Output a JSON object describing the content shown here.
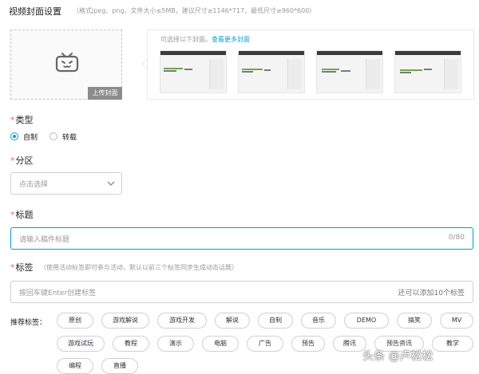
{
  "cover": {
    "title": "视频封面设置",
    "hint": "（格式jpeg、png，文件大小≤5MB，建议尺寸≥1146*717，最低尺寸≥960*600）",
    "upload_label": "上传封面",
    "suggest_text": "可选择以下封面。",
    "suggest_link": "查看更多封面"
  },
  "type": {
    "title": "类型",
    "options": [
      "自制",
      "转载"
    ],
    "selected": "自制"
  },
  "zone": {
    "title": "分区",
    "placeholder": "点击选择"
  },
  "video_title": {
    "title": "标题",
    "placeholder": "请输入稿件标题",
    "count": "0/80"
  },
  "tags": {
    "title": "标签",
    "hint": "（使用活动标签即可参与活动，默认以前三个标签同步生成动态话题）",
    "placeholder": "按回车键Enter创建标签",
    "remaining": "还可以添加10个标签",
    "recommend_label": "推荐标签：",
    "recommended": [
      "原创",
      "游戏解说",
      "游戏开发",
      "解说",
      "自制",
      "音乐",
      "DEMO",
      "搞笑",
      "MV",
      "游戏试玩",
      "教程",
      "演示",
      "电脑",
      "广告",
      "预告",
      "腾讯",
      "预告资讯",
      "教学",
      "编程",
      "直播"
    ]
  },
  "watermark": "头条 @卢松松",
  "colors": {
    "accent": "#00a1d6",
    "required": "#f25d8e",
    "border": "#ccd0d7"
  }
}
